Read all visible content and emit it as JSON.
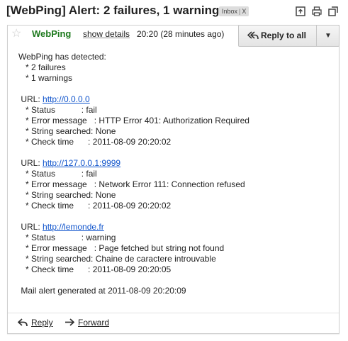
{
  "subject": {
    "title": "[WebPing] Alert: 2 failures, 1 warnings",
    "label": "Inbox",
    "label_close": "X"
  },
  "toolbar_icons": [
    "new-window-icon",
    "print-icon",
    "expand-icon"
  ],
  "message": {
    "sender": "WebPing",
    "show_details": "show details",
    "time": "20:20 (28 minutes ago)",
    "reply_all_label": "Reply to all",
    "more_icon": "▼",
    "lines": [
      "WebPing has detected:",
      "   * 2 failures",
      "   * 1 warnings",
      "",
      " URL: ",
      "   * Status           : fail",
      "   * Error message   : HTTP Error 401: Authorization Required",
      "   * String searched: None",
      "   * Check time      : 2011-08-09 20:20:02",
      "",
      " URL: ",
      "   * Status           : fail",
      "   * Error message   : Network Error 111: Connection refused",
      "   * String searched: None",
      "   * Check time      : 2011-08-09 20:20:02",
      "",
      " URL: ",
      "   * Status           : warning",
      "   * Error message   : Page fetched but string not found",
      "   * String searched: Chaine de caractere introuvable",
      "   * Check time      : 2011-08-09 20:20:05",
      "",
      " Mail alert generated at 2011-08-09 20:20:09"
    ],
    "urls": [
      "http://0.0.0.0",
      "http://127.0.0.1:9999",
      "http://lemonde.fr"
    ]
  },
  "footer": {
    "reply_label": "Reply",
    "forward_label": "Forward"
  },
  "colors": {
    "sender": "#1f7a1f",
    "link": "#1155cc",
    "label_bg": "#dddddd"
  }
}
